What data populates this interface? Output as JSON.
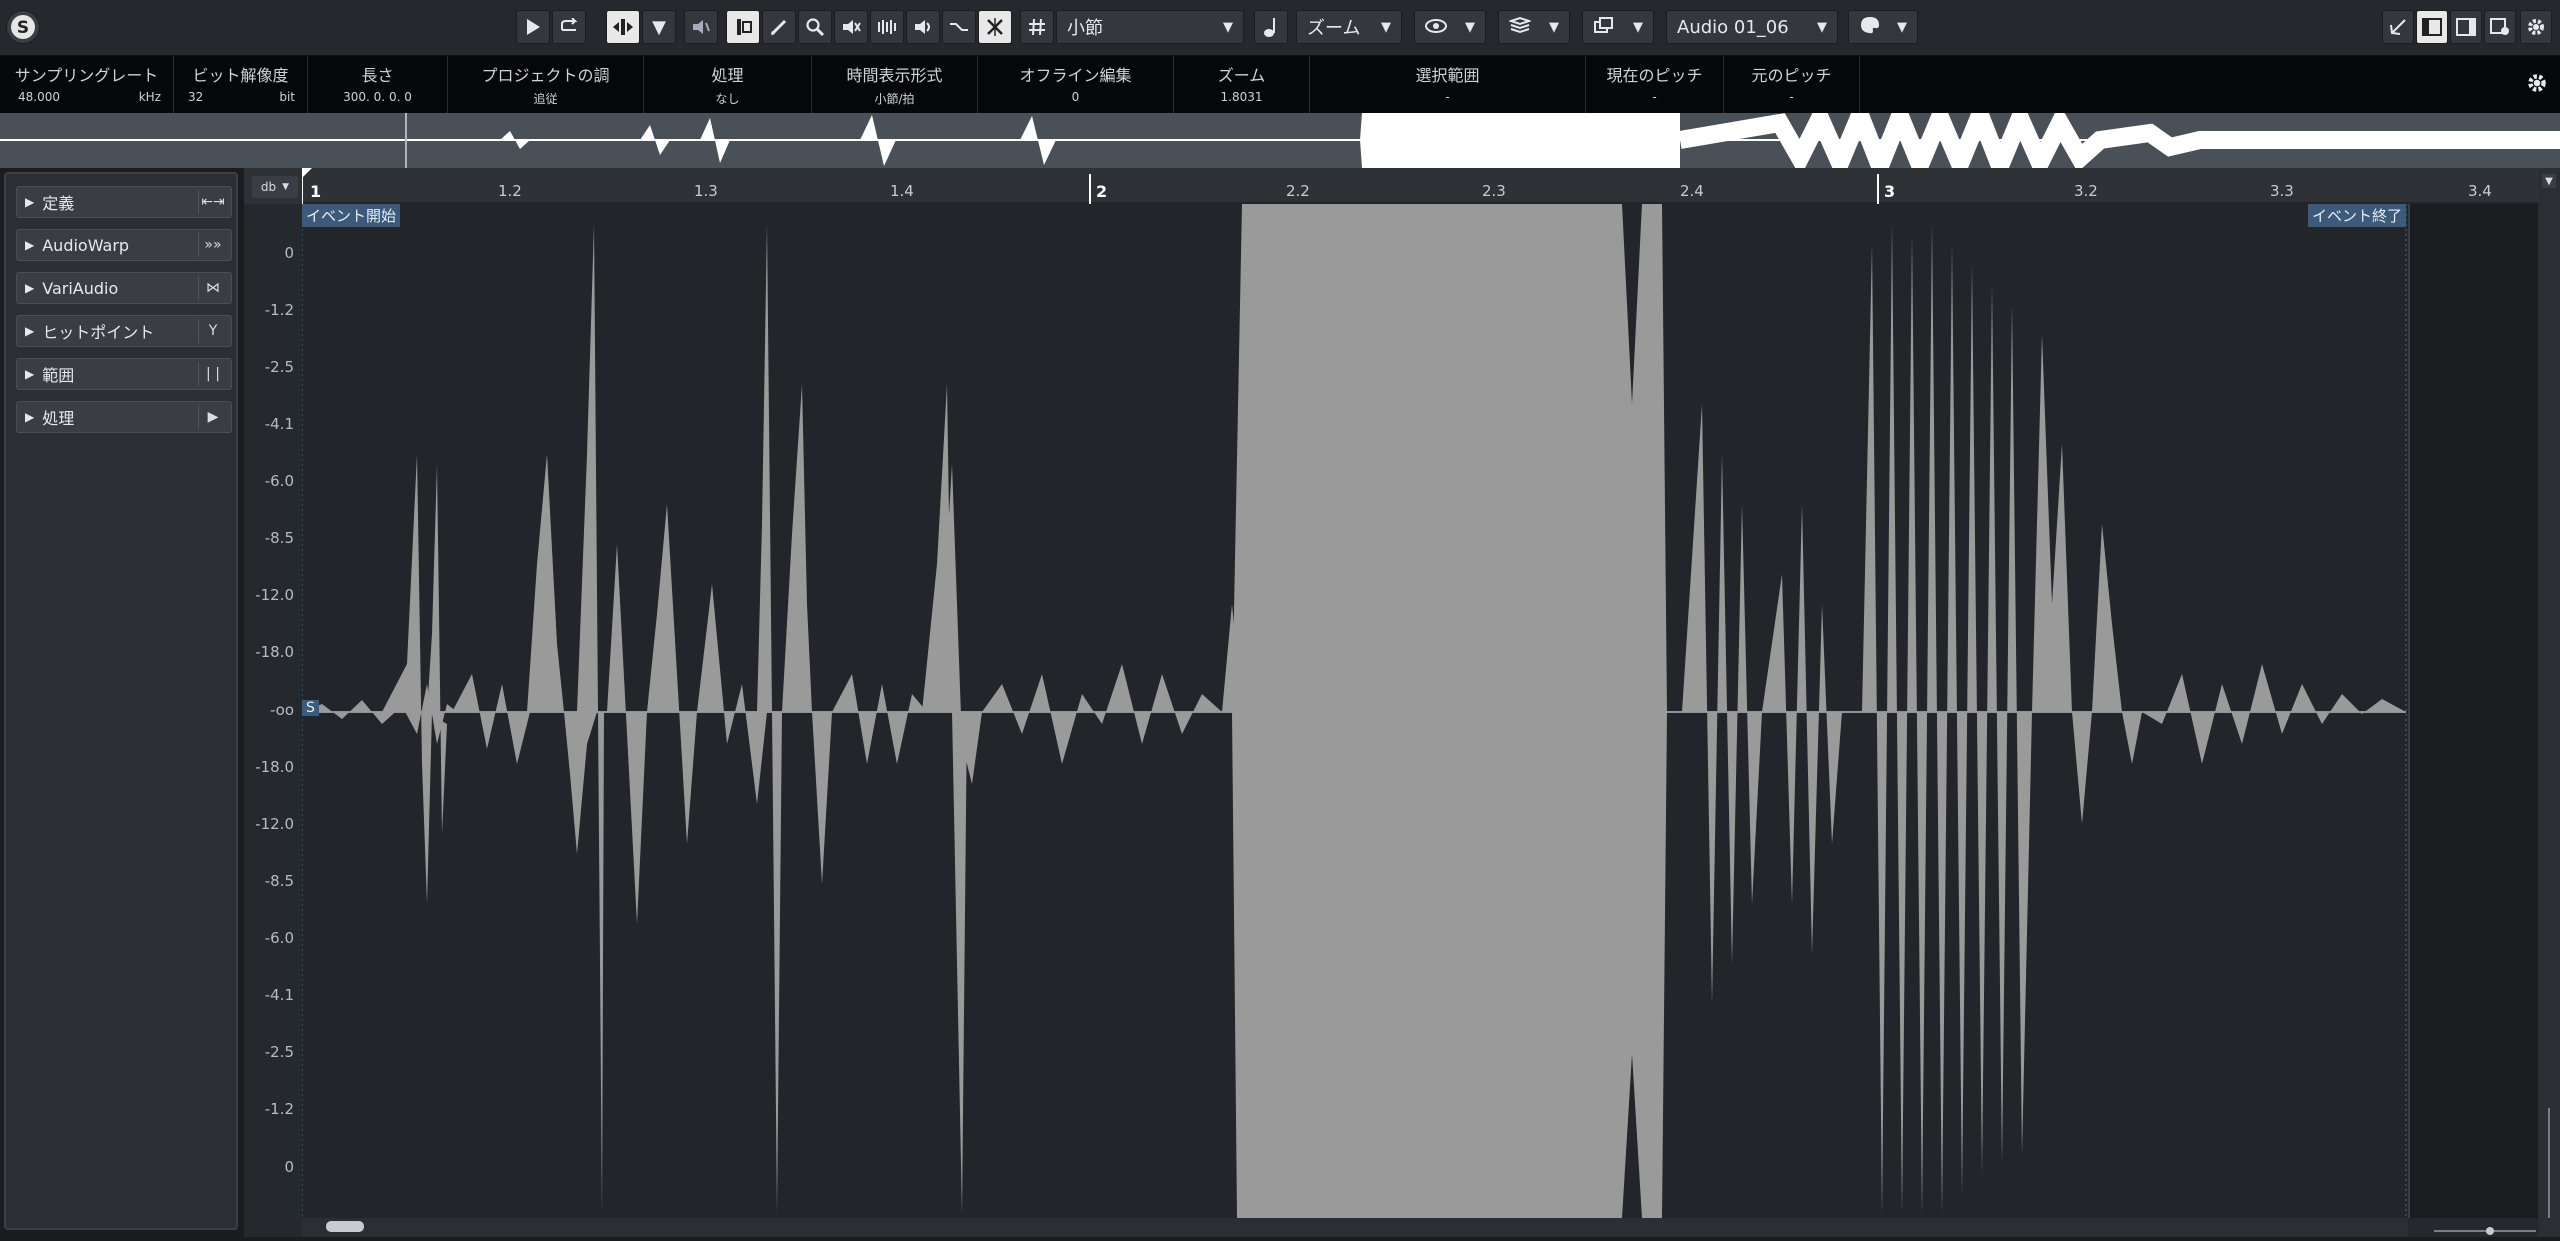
{
  "app_icon": "steinberg-logo",
  "toolbar": {
    "grid_type": "小節",
    "zoom_label": "ズーム",
    "audio_track": "Audio 01_06"
  },
  "infoline": {
    "sample_rate": {
      "label": "サンプリングレート",
      "value": "48.000",
      "unit": "kHz"
    },
    "bit_depth": {
      "label": "ビット解像度",
      "value": "32",
      "unit": "bit"
    },
    "length": {
      "label": "長さ",
      "value": "300. 0. 0. 0"
    },
    "project_key": {
      "label": "プロジェクトの調",
      "value": "追従"
    },
    "processing": {
      "label": "処理",
      "value": "なし"
    },
    "time_format": {
      "label": "時間表示形式",
      "value": "小節/拍"
    },
    "offline_edit": {
      "label": "オフライン編集",
      "value": "0"
    },
    "zoom": {
      "label": "ズーム",
      "value": "1.8031"
    },
    "selection_range": {
      "label": "選択範囲",
      "value": "-"
    },
    "current_pitch": {
      "label": "現在のピッチ",
      "value": "-"
    },
    "original_pitch": {
      "label": "元のピッチ",
      "value": "-"
    }
  },
  "left_panel": {
    "items": [
      {
        "label": "定義",
        "icon": "definition-icon"
      },
      {
        "label": "AudioWarp",
        "icon": "warp-icon"
      },
      {
        "label": "VariAudio",
        "icon": "variaudio-icon"
      },
      {
        "label": "ヒットポイント",
        "icon": "hitpoint-icon"
      },
      {
        "label": "範囲",
        "icon": "range-icon"
      },
      {
        "label": "処理",
        "icon": "process-icon"
      }
    ]
  },
  "ruler": {
    "unit": "db",
    "ticks": [
      "1",
      "1.2",
      "1.3",
      "1.4",
      "2",
      "2.2",
      "2.3",
      "2.4",
      "3",
      "3.2",
      "3.3",
      "3.4"
    ]
  },
  "y_axis": {
    "labels_top": [
      "0",
      "-1.2",
      "-2.5",
      "-4.1",
      "-6.0",
      "-8.5",
      "-12.0",
      "-18.0"
    ],
    "center": "-oo",
    "labels_bottom": [
      "-18.0",
      "-12.0",
      "-8.5",
      "-6.0",
      "-4.1",
      "-2.5",
      "-1.2",
      "0"
    ]
  },
  "event_start": "イベント開始",
  "event_end": "イベント終了",
  "snap_marker": "S"
}
